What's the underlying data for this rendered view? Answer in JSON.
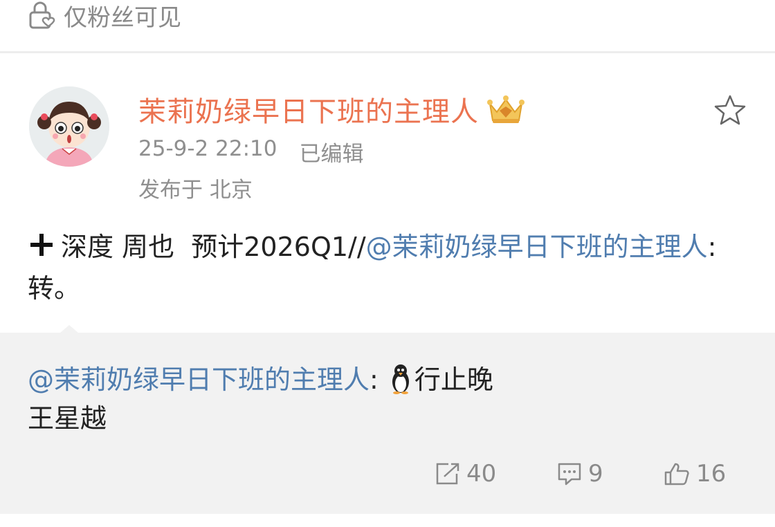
{
  "header": {
    "visibility_icon": "lock-heart-icon",
    "visibility_label": "仅粉丝可见"
  },
  "post": {
    "username": "茉莉奶绿早日下班的主理人",
    "badge_icon": "vip-crown-icon",
    "time": "25-9-2 22:10",
    "edited": "已编辑",
    "location": "发布于 北京",
    "star_icon": "star-outline-icon",
    "content": {
      "plus_icon": "plus-icon",
      "text_before": "深度 周也  预计2026Q1//",
      "mention": "@茉莉奶绿早日下班的主理人",
      "text_after": ":转。"
    }
  },
  "repost": {
    "mention": "@茉莉奶绿早日下班的主理人",
    "colon": ":",
    "emoji": "penguin-icon",
    "text_line1": "行止晚",
    "text_line2": "王星越"
  },
  "actions": {
    "share_count": "40",
    "comment_count": "9",
    "like_count": "16"
  },
  "colors": {
    "username": "#eb7350",
    "mention": "#507daf",
    "meta": "#8f8f8f"
  }
}
